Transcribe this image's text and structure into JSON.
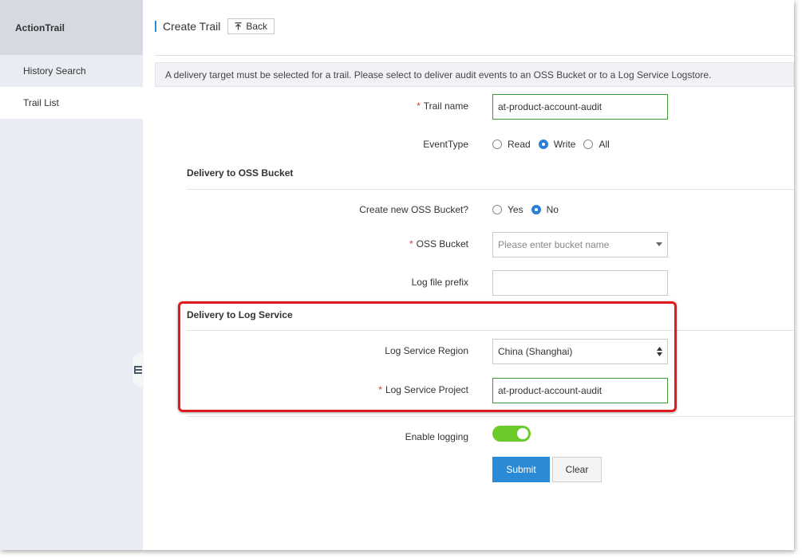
{
  "colors": {
    "accent": "#2b8ad6",
    "highlight": "#e0191e",
    "toggle_on": "#6acb2a",
    "valid_border": "#3d9b35"
  },
  "sidebar": {
    "title": "ActionTrail",
    "items": [
      {
        "label": "History Search",
        "active": false
      },
      {
        "label": "Trail List",
        "active": true
      }
    ],
    "collapse_icon": "collapse-icon"
  },
  "header": {
    "title": "Create Trail",
    "back_label": "Back",
    "back_icon": "upload-arrow-icon"
  },
  "notice": "A delivery target must be selected for a trail. Please select to deliver audit events to an OSS Bucket or to a Log Service Logstore.",
  "form": {
    "trail_name": {
      "label": "Trail name",
      "required": "*",
      "value": "at-product-account-audit"
    },
    "event_type": {
      "label": "EventType",
      "options": [
        "Read",
        "Write",
        "All"
      ],
      "selected": "Write"
    },
    "oss_section": {
      "title": "Delivery to OSS Bucket"
    },
    "create_oss": {
      "label": "Create new OSS Bucket?",
      "options": [
        "Yes",
        "No"
      ],
      "selected": "No"
    },
    "oss_bucket": {
      "label": "OSS Bucket",
      "required": "*",
      "placeholder": "Please enter bucket name"
    },
    "log_prefix": {
      "label": "Log file prefix",
      "value": ""
    },
    "log_section": {
      "title": "Delivery to Log Service"
    },
    "log_region": {
      "label": "Log Service Region",
      "value": "China (Shanghai)"
    },
    "log_project": {
      "label": "Log Service Project",
      "required": "*",
      "value": "at-product-account-audit"
    },
    "enable_logging": {
      "label": "Enable logging",
      "on": true
    },
    "submit_label": "Submit",
    "clear_label": "Clear"
  }
}
